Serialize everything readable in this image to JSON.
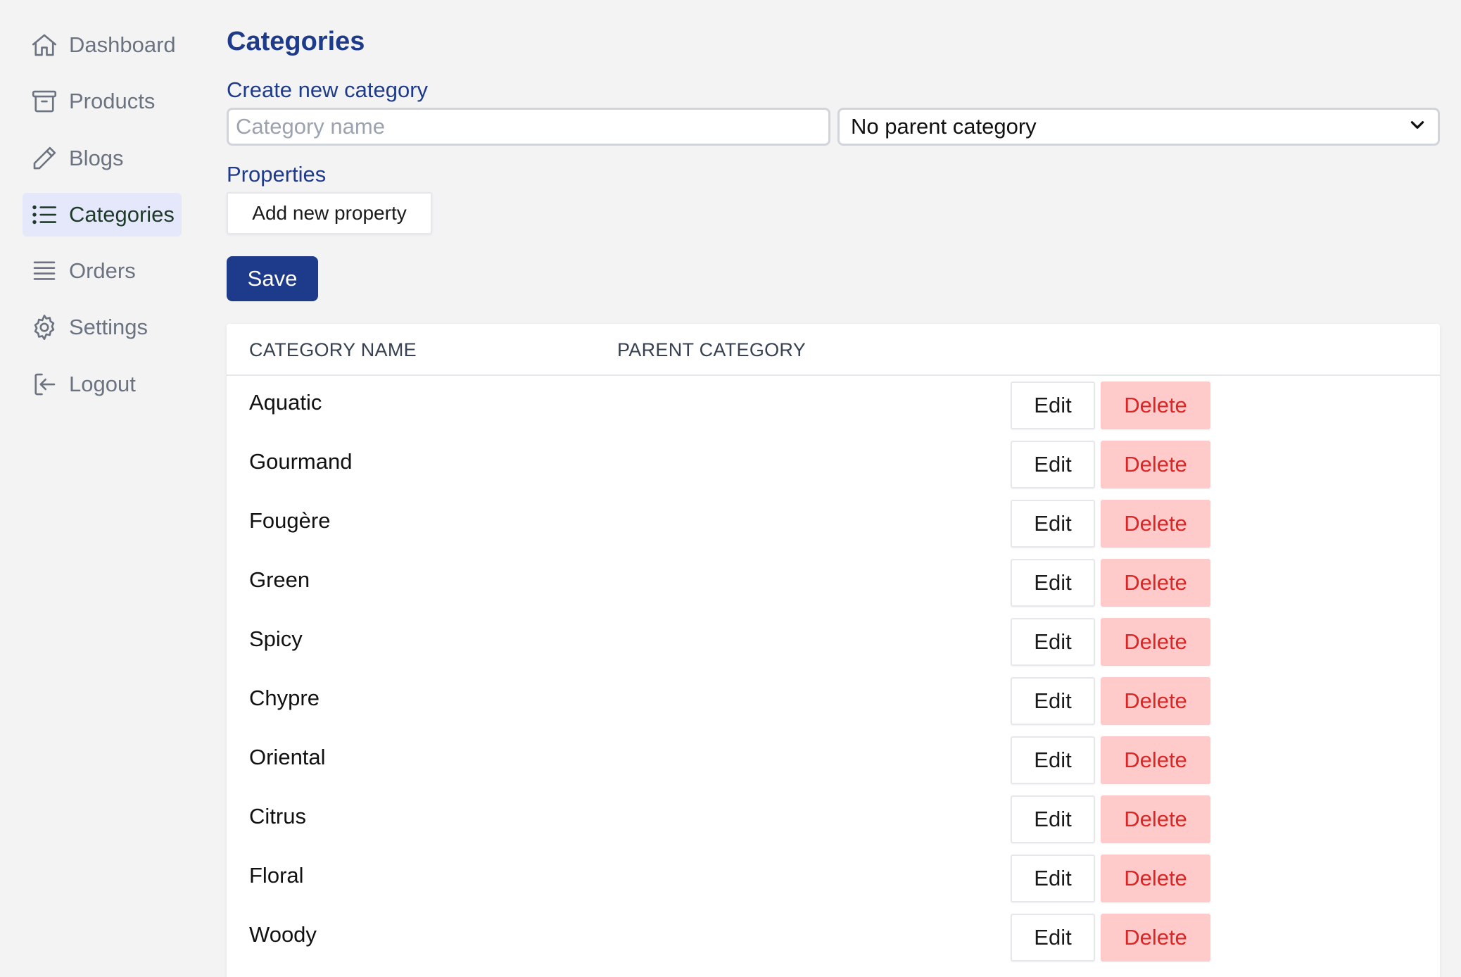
{
  "nav": {
    "items": [
      {
        "label": "Dashboard",
        "icon": "home-icon",
        "active": false
      },
      {
        "label": "Products",
        "icon": "archive-box-icon",
        "active": false
      },
      {
        "label": "Blogs",
        "icon": "pencil-icon",
        "active": false
      },
      {
        "label": "Categories",
        "icon": "list-icon",
        "active": true
      },
      {
        "label": "Orders",
        "icon": "queue-list-icon",
        "active": false
      },
      {
        "label": "Settings",
        "icon": "gear-icon",
        "active": false
      },
      {
        "label": "Logout",
        "icon": "logout-icon",
        "active": false
      }
    ]
  },
  "page": {
    "title": "Categories",
    "create_label": "Create new category",
    "name_placeholder": "Category name",
    "name_value": "",
    "parent_select": "No parent category",
    "properties_label": "Properties",
    "add_property_label": "Add new property",
    "save_label": "Save"
  },
  "table": {
    "headers": [
      "CATEGORY NAME",
      "PARENT CATEGORY"
    ],
    "edit_label": "Edit",
    "delete_label": "Delete",
    "rows": [
      {
        "name": "Aquatic",
        "parent": ""
      },
      {
        "name": "Gourmand",
        "parent": ""
      },
      {
        "name": "Fougère",
        "parent": ""
      },
      {
        "name": "Green",
        "parent": ""
      },
      {
        "name": "Spicy",
        "parent": ""
      },
      {
        "name": "Chypre",
        "parent": ""
      },
      {
        "name": "Oriental",
        "parent": ""
      },
      {
        "name": "Citrus",
        "parent": ""
      },
      {
        "name": "Floral",
        "parent": ""
      },
      {
        "name": "Woody",
        "parent": ""
      }
    ]
  },
  "colors": {
    "accent": "#1e3a8a",
    "active_nav_bg": "#e5e7fb",
    "delete_bg": "#fecaca",
    "delete_text": "#dc2626"
  }
}
